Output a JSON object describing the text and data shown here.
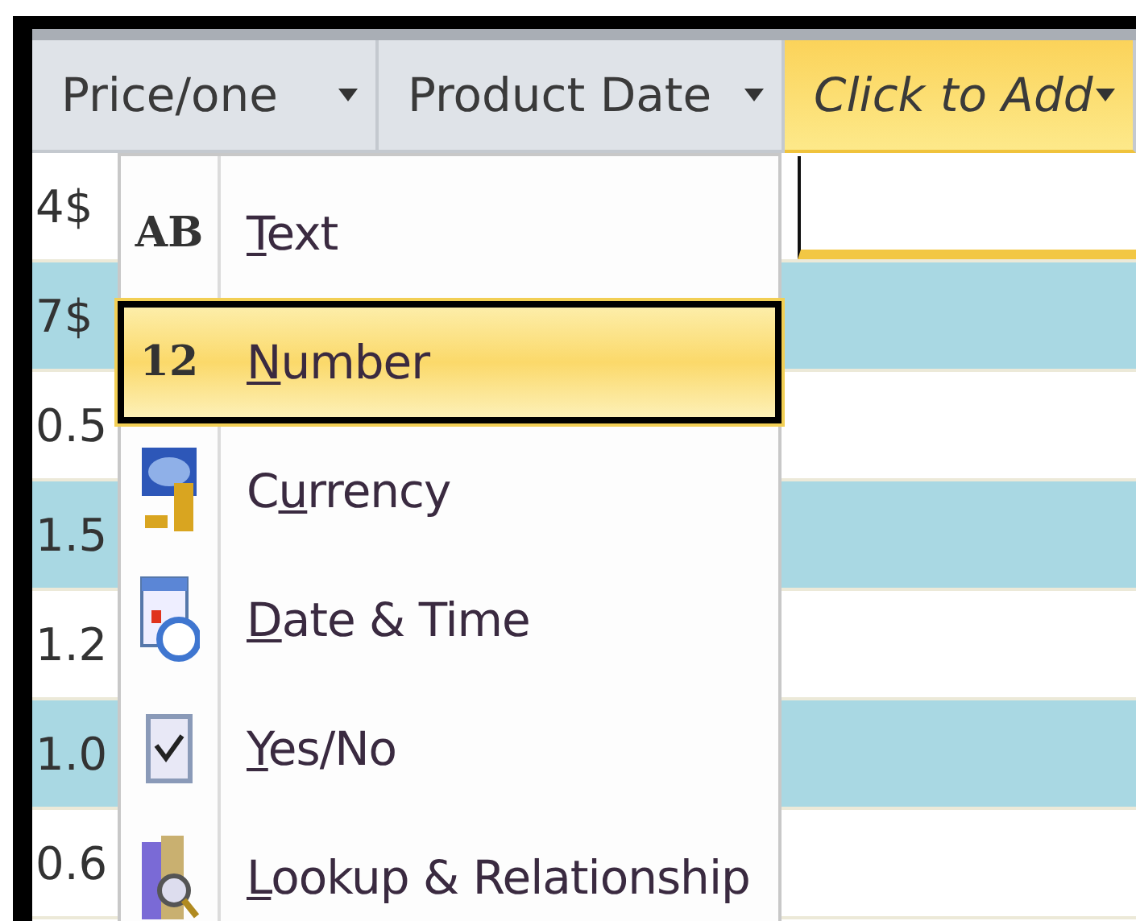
{
  "columns": [
    {
      "label": "Price/one",
      "selected": false
    },
    {
      "label": "Product Date",
      "selected": false
    },
    {
      "label": "Click to Add",
      "selected": true
    }
  ],
  "rows": [
    {
      "price": "4$"
    },
    {
      "price": "7$"
    },
    {
      "price": "0.5"
    },
    {
      "price": "1.5"
    },
    {
      "price": "1.2"
    },
    {
      "price": "1.0"
    },
    {
      "price": "0.6"
    }
  ],
  "menu": [
    {
      "kind": "glyph",
      "glyph": "AB",
      "access_key": "T",
      "label_rest": "ext",
      "selected": false
    },
    {
      "kind": "glyph",
      "glyph": "12",
      "access_key": "N",
      "label_rest": "umber",
      "selected": true
    },
    {
      "kind": "currency",
      "label_start": "C",
      "access_key": "u",
      "label_rest": "rrency",
      "selected": false
    },
    {
      "kind": "datetime",
      "access_key": "D",
      "label_rest": "ate & Time",
      "selected": false
    },
    {
      "kind": "yesno",
      "access_key": "Y",
      "label_rest": "es/No",
      "selected": false
    },
    {
      "kind": "lookup",
      "access_key": "L",
      "label_rest": "ookup & Relationship",
      "selected": false
    }
  ]
}
